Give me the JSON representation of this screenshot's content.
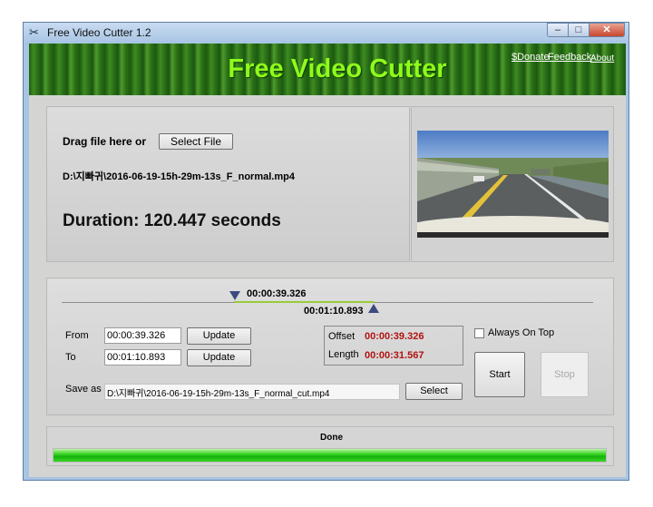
{
  "window": {
    "title": "Free Video Cutter 1.2",
    "icon": "scissors-icon",
    "controls": {
      "minimize": "–",
      "maximize": "□",
      "close": "✕"
    }
  },
  "header": {
    "title": "Free Video Cutter",
    "links": {
      "donate": "$Donate",
      "feedback": "Feedback",
      "about": "About"
    },
    "title_color": "#8dfc1a"
  },
  "source": {
    "drag_label": "Drag file here or",
    "select_file_label": "Select File",
    "file_path": "D:\\지빠귀\\2016-06-19-15h-29m-13s_F_normal.mp4",
    "duration_text": "Duration: 120.447 seconds"
  },
  "timeline": {
    "start_time": "00:00:39.326",
    "end_time": "00:01:10.893",
    "start_fraction": 0.3265,
    "end_fraction": 0.5886,
    "range_color": "#9aca3c"
  },
  "cut": {
    "from_label": "From",
    "to_label": "To",
    "from_value": "00:00:39.326",
    "to_value": "00:01:10.893",
    "update_label": "Update",
    "offset_label": "Offset",
    "offset_value": "00:00:39.326",
    "length_label": "Length",
    "length_value": "00:00:31.567",
    "value_color": "#b31212",
    "always_on_top_label": "Always On Top",
    "always_on_top_checked": false,
    "start_label": "Start",
    "stop_label": "Stop",
    "save_as_label": "Save as",
    "save_as_value": "D:\\지빠귀\\2016-06-19-15h-29m-13s_F_normal_cut.mp4",
    "select_label": "Select"
  },
  "status": {
    "text": "Done",
    "progress": 1.0,
    "progress_color": "#16b20c"
  }
}
